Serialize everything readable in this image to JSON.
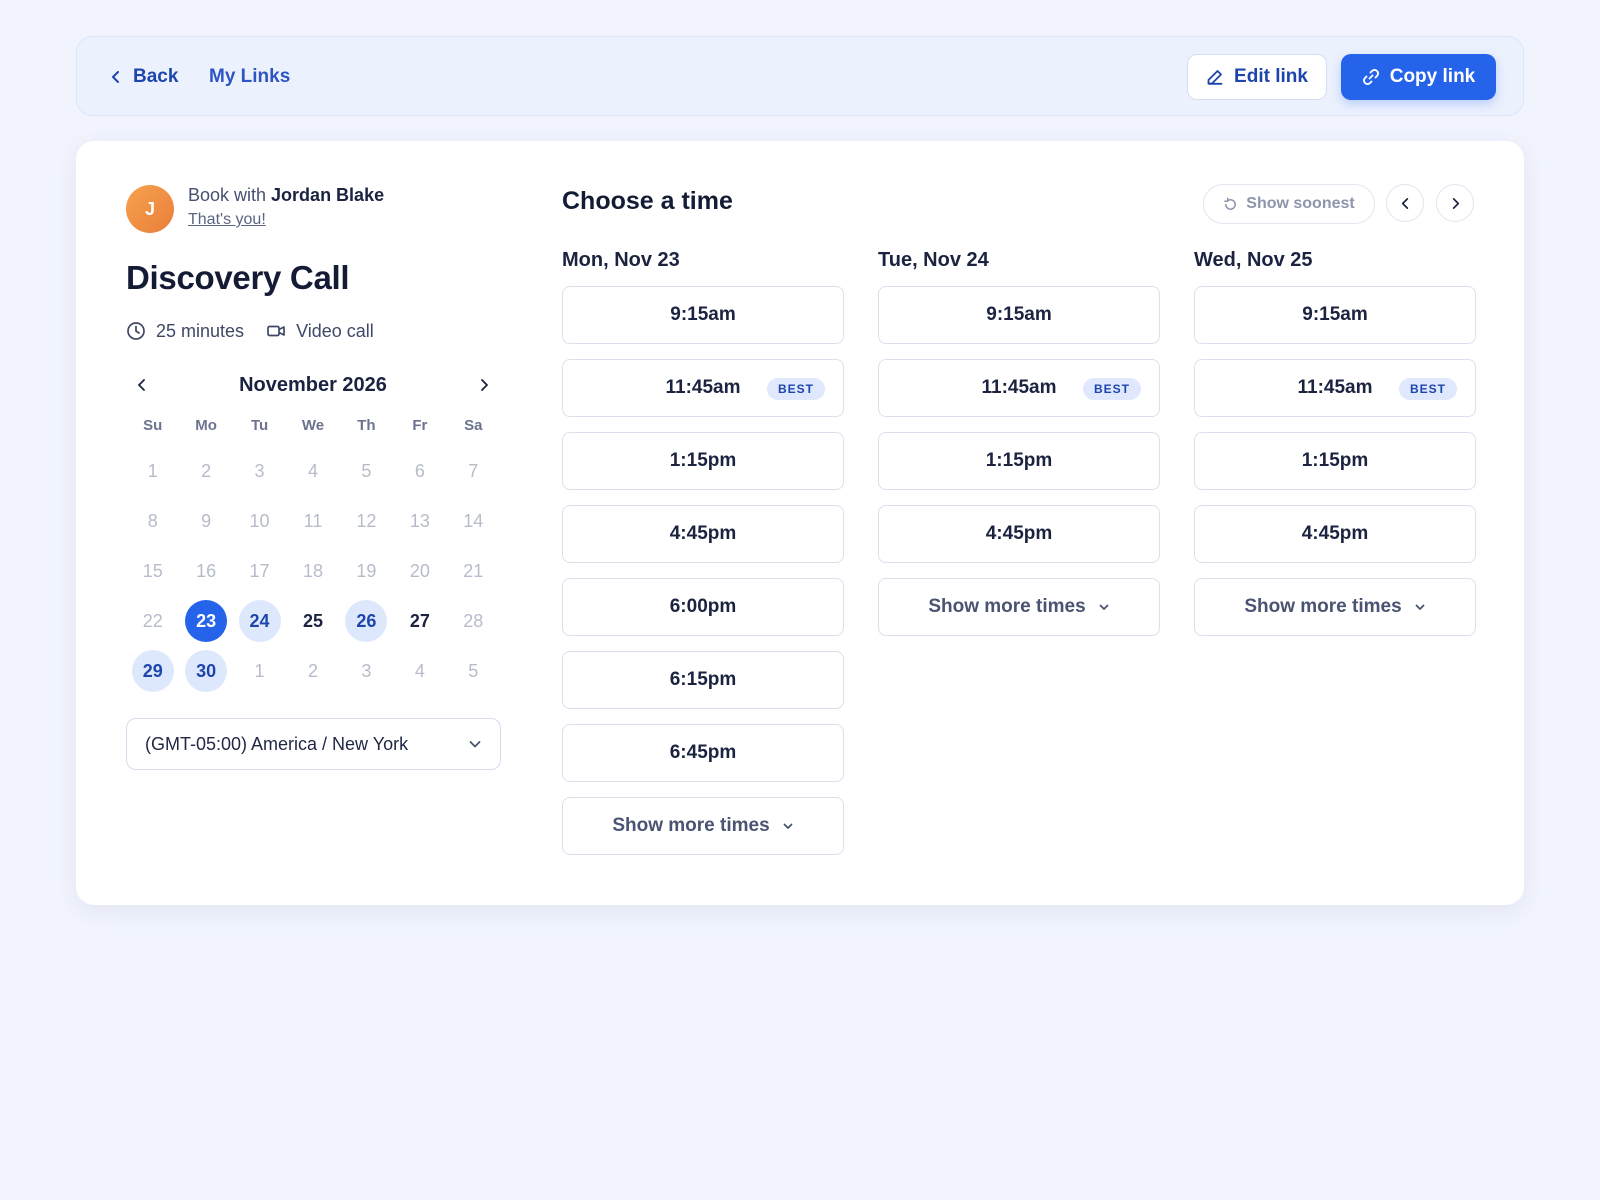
{
  "topbar": {
    "back_label": "Back",
    "my_links_label": "My Links",
    "edit_label": "Edit link",
    "copy_label": "Copy link"
  },
  "host": {
    "avatar_initial": "J",
    "book_with": "Book with ",
    "name": "Jordan Blake",
    "thats_you": "That's you!"
  },
  "event": {
    "title": "Discovery Call",
    "duration": "25 minutes",
    "location": "Video call"
  },
  "calendar": {
    "month_label": "November 2026",
    "weekdays": [
      "Su",
      "Mo",
      "Tu",
      "We",
      "Th",
      "Fr",
      "Sa"
    ],
    "days": [
      {
        "d": "1",
        "state": "disabled"
      },
      {
        "d": "2",
        "state": "disabled"
      },
      {
        "d": "3",
        "state": "disabled"
      },
      {
        "d": "4",
        "state": "disabled"
      },
      {
        "d": "5",
        "state": "disabled"
      },
      {
        "d": "6",
        "state": "disabled"
      },
      {
        "d": "7",
        "state": "disabled"
      },
      {
        "d": "8",
        "state": "disabled"
      },
      {
        "d": "9",
        "state": "disabled"
      },
      {
        "d": "10",
        "state": "disabled"
      },
      {
        "d": "11",
        "state": "disabled"
      },
      {
        "d": "12",
        "state": "disabled"
      },
      {
        "d": "13",
        "state": "disabled"
      },
      {
        "d": "14",
        "state": "disabled"
      },
      {
        "d": "15",
        "state": "disabled"
      },
      {
        "d": "16",
        "state": "disabled"
      },
      {
        "d": "17",
        "state": "disabled"
      },
      {
        "d": "18",
        "state": "disabled"
      },
      {
        "d": "19",
        "state": "disabled"
      },
      {
        "d": "20",
        "state": "disabled"
      },
      {
        "d": "21",
        "state": "disabled"
      },
      {
        "d": "22",
        "state": "disabled"
      },
      {
        "d": "23",
        "state": "selected"
      },
      {
        "d": "24",
        "state": "highlighted"
      },
      {
        "d": "25",
        "state": "available"
      },
      {
        "d": "26",
        "state": "highlighted"
      },
      {
        "d": "27",
        "state": "available"
      },
      {
        "d": "28",
        "state": "disabled"
      },
      {
        "d": "29",
        "state": "highlighted"
      },
      {
        "d": "30",
        "state": "highlighted"
      },
      {
        "d": "1",
        "state": "disabled"
      },
      {
        "d": "2",
        "state": "disabled"
      },
      {
        "d": "3",
        "state": "disabled"
      },
      {
        "d": "4",
        "state": "disabled"
      },
      {
        "d": "5",
        "state": "disabled"
      }
    ]
  },
  "timezone": "(GMT-05:00) America / New York",
  "times": {
    "title": "Choose a time",
    "show_soonest": "Show soonest",
    "best_badge": "BEST",
    "show_more": "Show more times",
    "columns": [
      {
        "date": "Mon, Nov 23",
        "slots": [
          {
            "time": "9:15am",
            "best": false
          },
          {
            "time": "11:45am",
            "best": true
          },
          {
            "time": "1:15pm",
            "best": false
          },
          {
            "time": "4:45pm",
            "best": false
          },
          {
            "time": "6:00pm",
            "best": false
          },
          {
            "time": "6:15pm",
            "best": false
          },
          {
            "time": "6:45pm",
            "best": false
          }
        ]
      },
      {
        "date": "Tue, Nov 24",
        "slots": [
          {
            "time": "9:15am",
            "best": false
          },
          {
            "time": "11:45am",
            "best": true
          },
          {
            "time": "1:15pm",
            "best": false
          },
          {
            "time": "4:45pm",
            "best": false
          }
        ]
      },
      {
        "date": "Wed, Nov 25",
        "slots": [
          {
            "time": "9:15am",
            "best": false
          },
          {
            "time": "11:45am",
            "best": true
          },
          {
            "time": "1:15pm",
            "best": false
          },
          {
            "time": "4:45pm",
            "best": false
          }
        ]
      }
    ]
  },
  "colors": {
    "accent": "#2563eb",
    "accent_text": "#1e45ad",
    "highlight_bg": "#dde8fd",
    "page_bg": "#f1f4fd"
  },
  "icons": {
    "back": "chevron-left-icon",
    "edit": "pencil-icon",
    "copy": "link-icon",
    "duration": "clock-icon",
    "location": "video-camera-icon",
    "soonest": "refresh-icon",
    "more": "chevron-down-icon"
  }
}
